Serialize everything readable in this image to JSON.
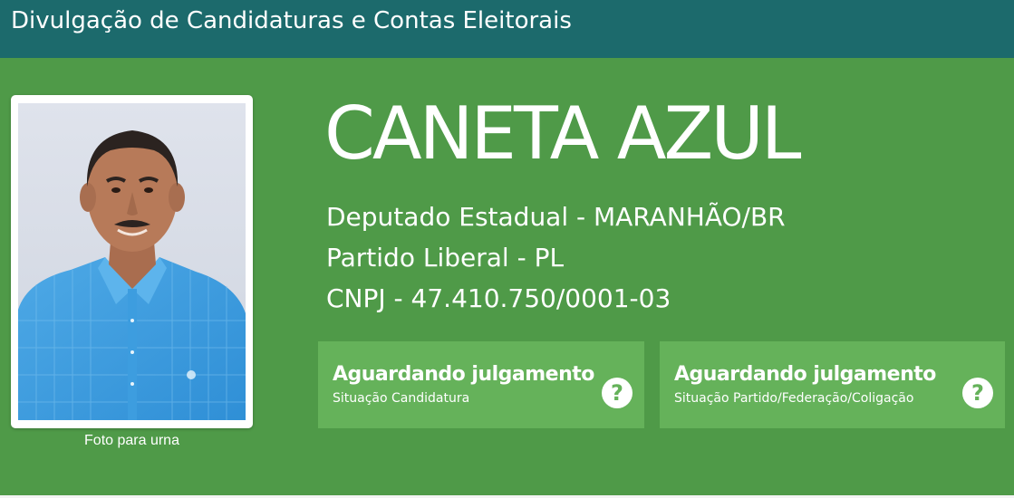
{
  "header": {
    "title": "Divulgação de Candidaturas e Contas Eleitorais"
  },
  "candidate": {
    "photo_caption": "Foto para urna",
    "name": "CANETA AZUL",
    "office": "Deputado Estadual - MARANHÃO/BR",
    "party": "Partido Liberal - PL",
    "cnpj": "CNPJ - 47.410.750/0001-03"
  },
  "status_cards": [
    {
      "status": "Aguardando julgamento",
      "label": "Situação Candidatura",
      "icon": "question-circle-icon"
    },
    {
      "status": "Aguardando julgamento",
      "label": "Situação Partido/Federação/Coligação",
      "icon": "question-circle-icon"
    }
  ],
  "colors": {
    "header_bg": "#1c6a6c",
    "panel_bg": "#4f9a48",
    "card_bg": "#65b25a",
    "text": "#ffffff"
  }
}
